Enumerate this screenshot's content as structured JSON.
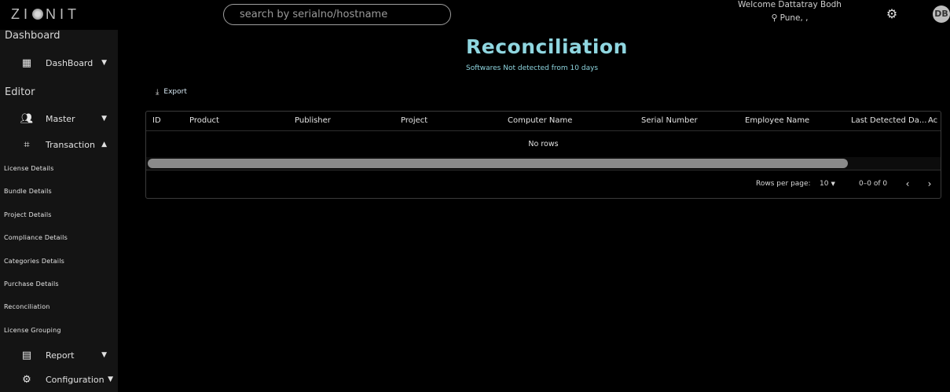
{
  "header": {
    "logo_text_left": "ZI",
    "logo_text_right": "NIT",
    "search_placeholder": "search by serialno/hostname",
    "welcome": "Welcome Dattatray Bodh",
    "location": "Pune, ,",
    "avatar_initials": "DB"
  },
  "sidebar": {
    "dashboard_heading": "Dashboard",
    "dashboard_item": "DashBoard",
    "editor_heading": "Editor",
    "master_item": "Master",
    "transaction_item": "Transaction",
    "transaction_sub": [
      "License Details",
      "Bundle Details",
      "Project Details",
      "Compliance Details",
      "Categories Details",
      "Purchase Details",
      "Reconciliation",
      "License Grouping"
    ],
    "report_item": "Report",
    "configuration_item": "Configuration"
  },
  "main": {
    "title": "Reconciliation",
    "subtitle": "Softwares Not detected from 10 days",
    "export_label": "Export",
    "columns": [
      "ID",
      "Product",
      "Publisher",
      "Project",
      "Computer Name",
      "Serial Number",
      "Employee Name",
      "Last Detected Da...",
      "Ac"
    ],
    "no_rows": "No rows",
    "rows_per_page_label": "Rows per page:",
    "rows_per_page_value": "10",
    "range_text": "0–0 of 0"
  },
  "colors": {
    "accent": "#8fd6e0",
    "sidebar_bg": "#141414",
    "background": "#000000"
  }
}
